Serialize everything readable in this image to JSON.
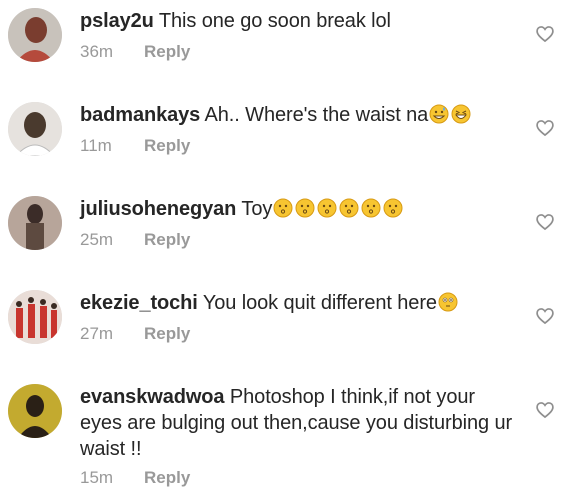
{
  "comments": [
    {
      "username": "pslay2u",
      "text": "This one go soon break lol",
      "emojis": [],
      "time": "36m",
      "reply_label": "Reply",
      "avatar_colors": [
        "#7a3d2f",
        "#c8c2bb"
      ]
    },
    {
      "username": "badmankays",
      "text": "Ah.. Where's the waist na",
      "emojis": [
        "grinning-sweat-face",
        "grinning-squint-face"
      ],
      "time": "11m",
      "reply_label": "Reply",
      "avatar_colors": [
        "#4a3a2e",
        "#e6e2de"
      ]
    },
    {
      "username": "juliusohenegyan",
      "text": "Toy",
      "emojis": [
        "kissing-face",
        "kissing-face",
        "kissing-face",
        "kissing-face",
        "kissing-face",
        "kissing-face"
      ],
      "time": "25m",
      "reply_label": "Reply",
      "avatar_colors": [
        "#3b2c28",
        "#b7a59a"
      ]
    },
    {
      "username": "ekezie_tochi",
      "text": "You look quit different here",
      "emojis": [
        "flushed-face"
      ],
      "time": "27m",
      "reply_label": "Reply",
      "avatar_colors": [
        "#c8352e",
        "#e9ddd7"
      ]
    },
    {
      "username": "evanskwadwoa",
      "text": "Photoshop I think,if not your eyes are bulging out then,cause you disturbing ur waist !!",
      "emojis": [],
      "time": "15m",
      "reply_label": "Reply",
      "avatar_colors": [
        "#c3aa2f",
        "#2a2016"
      ]
    }
  ]
}
